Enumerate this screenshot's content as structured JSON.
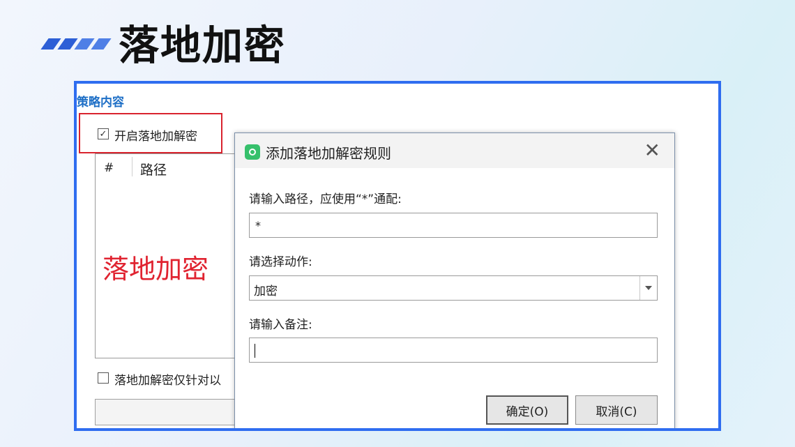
{
  "slide": {
    "title": "落地加密"
  },
  "panel": {
    "section_title": "策略内容",
    "enable_checkbox_label": "开启落地加解密",
    "enable_checked_mark": "✓",
    "columns": [
      "#",
      "路径"
    ],
    "annotation": "落地加密",
    "only_checkbox_label": "落地加解密仅针对以"
  },
  "dialog": {
    "title": "添加落地加解密规则",
    "close_glyph": "✕",
    "path_label": "请输入路径，应使用“*”通配:",
    "path_value": "*",
    "action_label": "请选择动作:",
    "action_value": "加密",
    "note_label": "请输入备注:",
    "note_value": "",
    "ok_label": "确定(O)",
    "cancel_label": "取消(C)"
  },
  "colors": {
    "frame_border": "#2f6df0",
    "annotation_red": "#e02330",
    "section_title": "#1e6fc6"
  }
}
